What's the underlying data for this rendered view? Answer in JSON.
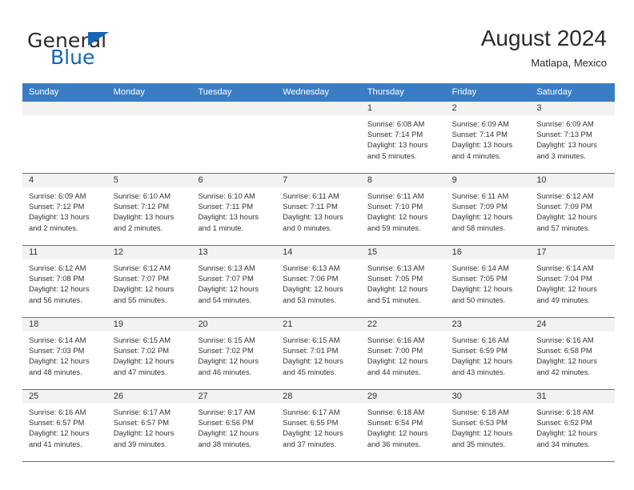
{
  "brand": {
    "name_part1": "General",
    "name_part2": "Blue",
    "triangle_color": "#1565b8"
  },
  "header": {
    "title": "August 2024",
    "subtitle": "Matlapa, Mexico"
  },
  "colors": {
    "header_blue": "#3a7dc4",
    "day_band_gray": "#f2f2f2",
    "text": "#333333"
  },
  "weekdays": [
    "Sunday",
    "Monday",
    "Tuesday",
    "Wednesday",
    "Thursday",
    "Friday",
    "Saturday"
  ],
  "weeks": [
    [
      {
        "day": "",
        "sunrise": "",
        "sunset": "",
        "daylight1": "",
        "daylight2": ""
      },
      {
        "day": "",
        "sunrise": "",
        "sunset": "",
        "daylight1": "",
        "daylight2": ""
      },
      {
        "day": "",
        "sunrise": "",
        "sunset": "",
        "daylight1": "",
        "daylight2": ""
      },
      {
        "day": "",
        "sunrise": "",
        "sunset": "",
        "daylight1": "",
        "daylight2": ""
      },
      {
        "day": "1",
        "sunrise": "Sunrise: 6:08 AM",
        "sunset": "Sunset: 7:14 PM",
        "daylight1": "Daylight: 13 hours",
        "daylight2": "and 5 minutes."
      },
      {
        "day": "2",
        "sunrise": "Sunrise: 6:09 AM",
        "sunset": "Sunset: 7:14 PM",
        "daylight1": "Daylight: 13 hours",
        "daylight2": "and 4 minutes."
      },
      {
        "day": "3",
        "sunrise": "Sunrise: 6:09 AM",
        "sunset": "Sunset: 7:13 PM",
        "daylight1": "Daylight: 13 hours",
        "daylight2": "and 3 minutes."
      }
    ],
    [
      {
        "day": "4",
        "sunrise": "Sunrise: 6:09 AM",
        "sunset": "Sunset: 7:12 PM",
        "daylight1": "Daylight: 13 hours",
        "daylight2": "and 2 minutes."
      },
      {
        "day": "5",
        "sunrise": "Sunrise: 6:10 AM",
        "sunset": "Sunset: 7:12 PM",
        "daylight1": "Daylight: 13 hours",
        "daylight2": "and 2 minutes."
      },
      {
        "day": "6",
        "sunrise": "Sunrise: 6:10 AM",
        "sunset": "Sunset: 7:11 PM",
        "daylight1": "Daylight: 13 hours",
        "daylight2": "and 1 minute."
      },
      {
        "day": "7",
        "sunrise": "Sunrise: 6:11 AM",
        "sunset": "Sunset: 7:11 PM",
        "daylight1": "Daylight: 13 hours",
        "daylight2": "and 0 minutes."
      },
      {
        "day": "8",
        "sunrise": "Sunrise: 6:11 AM",
        "sunset": "Sunset: 7:10 PM",
        "daylight1": "Daylight: 12 hours",
        "daylight2": "and 59 minutes."
      },
      {
        "day": "9",
        "sunrise": "Sunrise: 6:11 AM",
        "sunset": "Sunset: 7:09 PM",
        "daylight1": "Daylight: 12 hours",
        "daylight2": "and 58 minutes."
      },
      {
        "day": "10",
        "sunrise": "Sunrise: 6:12 AM",
        "sunset": "Sunset: 7:09 PM",
        "daylight1": "Daylight: 12 hours",
        "daylight2": "and 57 minutes."
      }
    ],
    [
      {
        "day": "11",
        "sunrise": "Sunrise: 6:12 AM",
        "sunset": "Sunset: 7:08 PM",
        "daylight1": "Daylight: 12 hours",
        "daylight2": "and 56 minutes."
      },
      {
        "day": "12",
        "sunrise": "Sunrise: 6:12 AM",
        "sunset": "Sunset: 7:07 PM",
        "daylight1": "Daylight: 12 hours",
        "daylight2": "and 55 minutes."
      },
      {
        "day": "13",
        "sunrise": "Sunrise: 6:13 AM",
        "sunset": "Sunset: 7:07 PM",
        "daylight1": "Daylight: 12 hours",
        "daylight2": "and 54 minutes."
      },
      {
        "day": "14",
        "sunrise": "Sunrise: 6:13 AM",
        "sunset": "Sunset: 7:06 PM",
        "daylight1": "Daylight: 12 hours",
        "daylight2": "and 53 minutes."
      },
      {
        "day": "15",
        "sunrise": "Sunrise: 6:13 AM",
        "sunset": "Sunset: 7:05 PM",
        "daylight1": "Daylight: 12 hours",
        "daylight2": "and 51 minutes."
      },
      {
        "day": "16",
        "sunrise": "Sunrise: 6:14 AM",
        "sunset": "Sunset: 7:05 PM",
        "daylight1": "Daylight: 12 hours",
        "daylight2": "and 50 minutes."
      },
      {
        "day": "17",
        "sunrise": "Sunrise: 6:14 AM",
        "sunset": "Sunset: 7:04 PM",
        "daylight1": "Daylight: 12 hours",
        "daylight2": "and 49 minutes."
      }
    ],
    [
      {
        "day": "18",
        "sunrise": "Sunrise: 6:14 AM",
        "sunset": "Sunset: 7:03 PM",
        "daylight1": "Daylight: 12 hours",
        "daylight2": "and 48 minutes."
      },
      {
        "day": "19",
        "sunrise": "Sunrise: 6:15 AM",
        "sunset": "Sunset: 7:02 PM",
        "daylight1": "Daylight: 12 hours",
        "daylight2": "and 47 minutes."
      },
      {
        "day": "20",
        "sunrise": "Sunrise: 6:15 AM",
        "sunset": "Sunset: 7:02 PM",
        "daylight1": "Daylight: 12 hours",
        "daylight2": "and 46 minutes."
      },
      {
        "day": "21",
        "sunrise": "Sunrise: 6:15 AM",
        "sunset": "Sunset: 7:01 PM",
        "daylight1": "Daylight: 12 hours",
        "daylight2": "and 45 minutes."
      },
      {
        "day": "22",
        "sunrise": "Sunrise: 6:16 AM",
        "sunset": "Sunset: 7:00 PM",
        "daylight1": "Daylight: 12 hours",
        "daylight2": "and 44 minutes."
      },
      {
        "day": "23",
        "sunrise": "Sunrise: 6:16 AM",
        "sunset": "Sunset: 6:59 PM",
        "daylight1": "Daylight: 12 hours",
        "daylight2": "and 43 minutes."
      },
      {
        "day": "24",
        "sunrise": "Sunrise: 6:16 AM",
        "sunset": "Sunset: 6:58 PM",
        "daylight1": "Daylight: 12 hours",
        "daylight2": "and 42 minutes."
      }
    ],
    [
      {
        "day": "25",
        "sunrise": "Sunrise: 6:16 AM",
        "sunset": "Sunset: 6:57 PM",
        "daylight1": "Daylight: 12 hours",
        "daylight2": "and 41 minutes."
      },
      {
        "day": "26",
        "sunrise": "Sunrise: 6:17 AM",
        "sunset": "Sunset: 6:57 PM",
        "daylight1": "Daylight: 12 hours",
        "daylight2": "and 39 minutes."
      },
      {
        "day": "27",
        "sunrise": "Sunrise: 6:17 AM",
        "sunset": "Sunset: 6:56 PM",
        "daylight1": "Daylight: 12 hours",
        "daylight2": "and 38 minutes."
      },
      {
        "day": "28",
        "sunrise": "Sunrise: 6:17 AM",
        "sunset": "Sunset: 6:55 PM",
        "daylight1": "Daylight: 12 hours",
        "daylight2": "and 37 minutes."
      },
      {
        "day": "29",
        "sunrise": "Sunrise: 6:18 AM",
        "sunset": "Sunset: 6:54 PM",
        "daylight1": "Daylight: 12 hours",
        "daylight2": "and 36 minutes."
      },
      {
        "day": "30",
        "sunrise": "Sunrise: 6:18 AM",
        "sunset": "Sunset: 6:53 PM",
        "daylight1": "Daylight: 12 hours",
        "daylight2": "and 35 minutes."
      },
      {
        "day": "31",
        "sunrise": "Sunrise: 6:18 AM",
        "sunset": "Sunset: 6:52 PM",
        "daylight1": "Daylight: 12 hours",
        "daylight2": "and 34 minutes."
      }
    ]
  ]
}
